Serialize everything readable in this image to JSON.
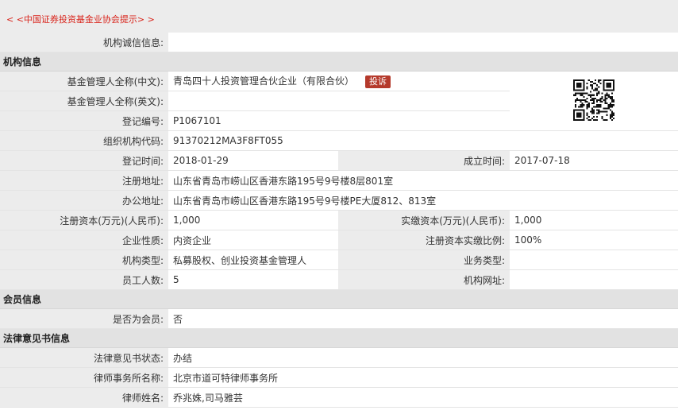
{
  "notice": "< <中国证券投资基金业协会提示> >",
  "credit": {
    "label": "机构诚信信息:",
    "value": ""
  },
  "org": {
    "section_title": "机构信息",
    "cn_name_label": "基金管理人全称(中文):",
    "cn_name": "青岛四十人投资管理合伙企业（有限合伙）",
    "complaint_label": "投诉",
    "en_name_label": "基金管理人全称(英文):",
    "en_name": "",
    "reg_no_label": "登记编号:",
    "reg_no": "P1067101",
    "org_code_label": "组织机构代码:",
    "org_code": "91370212MA3F8FT055",
    "reg_time_label": "登记时间:",
    "reg_time": "2018-01-29",
    "found_time_label": "成立时间:",
    "found_time": "2017-07-18",
    "reg_addr_label": "注册地址:",
    "reg_addr": "山东省青岛市崂山区香港东路195号9号楼8层801室",
    "office_addr_label": "办公地址:",
    "office_addr": "山东省青岛市崂山区香港东路195号9号楼PE大厦812、813室",
    "reg_capital_label": "注册资本(万元)(人民币):",
    "reg_capital": "1,000",
    "paid_capital_label": "实缴资本(万元)(人民币):",
    "paid_capital": "1,000",
    "nature_label": "企业性质:",
    "nature": "内资企业",
    "paid_ratio_label": "注册资本实缴比例:",
    "paid_ratio": "100%",
    "org_type_label": "机构类型:",
    "org_type": "私募股权、创业投资基金管理人",
    "biz_type_label": "业务类型:",
    "biz_type": "",
    "staff_label": "员工人数:",
    "staff": "5",
    "website_label": "机构网址:",
    "website": ""
  },
  "member": {
    "section_title": "会员信息",
    "is_member_label": "是否为会员:",
    "is_member": "否"
  },
  "legal": {
    "section_title": "法律意见书信息",
    "status_label": "法律意见书状态:",
    "status": "办结",
    "firm_label": "律师事务所名称:",
    "firm": "北京市道可特律师事务所",
    "lawyer_label": "律师姓名:",
    "lawyer": "乔兆姝,司马雅芸"
  }
}
